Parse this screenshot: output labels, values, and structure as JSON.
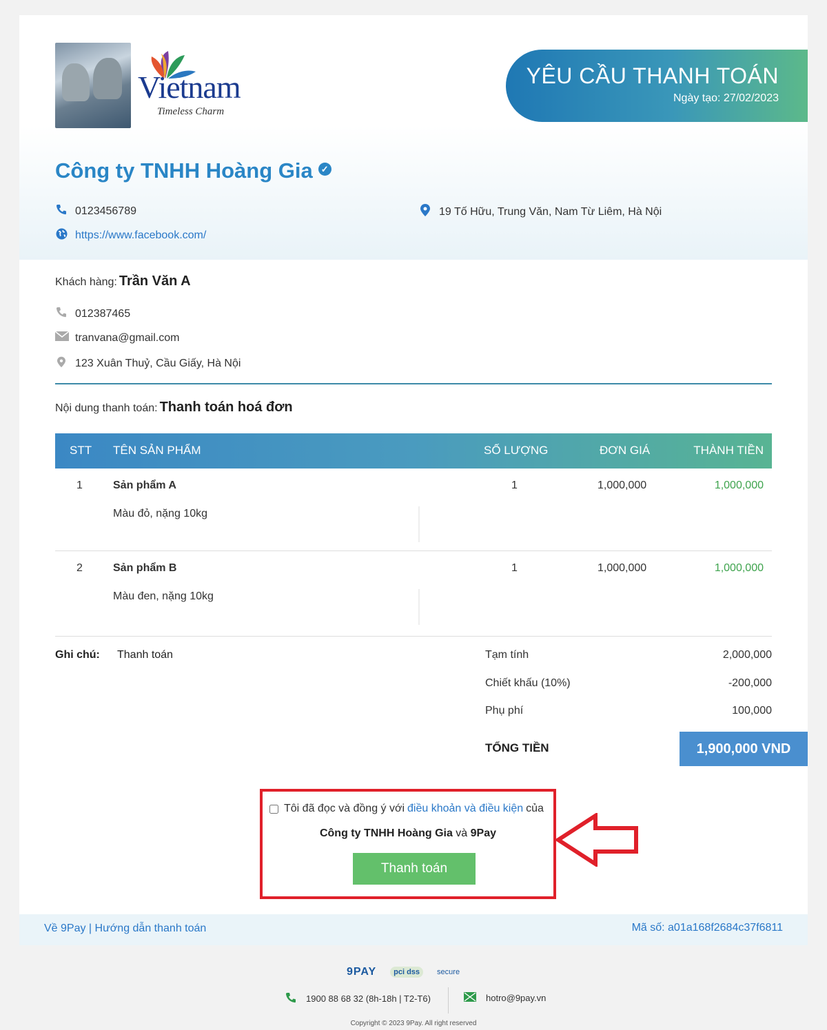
{
  "header": {
    "logo_word": "Vietnam",
    "logo_tagline": "Timeless Charm",
    "title": "YÊU CẦU THANH TOÁN",
    "created_date": "Ngày tạo: 27/02/2023"
  },
  "merchant": {
    "name": "Công ty TNHH Hoàng Gia",
    "phone": "0123456789",
    "address": "19 Tố Hữu, Trung Văn, Nam Từ Liêm, Hà Nội",
    "website": "https://www.facebook.com/"
  },
  "customer": {
    "label": "Khách hàng:",
    "name": "Trần Văn A",
    "phone": "012387465",
    "email": "tranvana@gmail.com",
    "address": "123 Xuân Thuỷ, Cầu Giấy, Hà Nội"
  },
  "payment": {
    "label": "Nội dung thanh toán:",
    "content": "Thanh toán hoá đơn"
  },
  "table": {
    "headers": {
      "stt": "STT",
      "product": "TÊN SẢN PHẨM",
      "qty": "SỐ LƯỢNG",
      "price": "ĐƠN GIÁ",
      "total": "THÀNH TIỀN"
    },
    "rows": [
      {
        "stt": "1",
        "name": "Sản phẩm A",
        "desc": "Màu đỏ, nặng 10kg",
        "qty": "1",
        "price": "1,000,000",
        "total": "1,000,000"
      },
      {
        "stt": "2",
        "name": "Sản phẩm B",
        "desc": "Màu đen, nặng 10kg",
        "qty": "1",
        "price": "1,000,000",
        "total": "1,000,000"
      }
    ]
  },
  "note": {
    "label": "Ghi chú:",
    "value": "Thanh toán"
  },
  "summary": {
    "subtotal_label": "Tạm tính",
    "subtotal": "2,000,000",
    "discount_label": "Chiết khấu (10%)",
    "discount": "-200,000",
    "fee_label": "Phụ phí",
    "fee": "100,000",
    "total_label": "TỔNG TIỀN",
    "total": "1,900,000 VND"
  },
  "consent": {
    "text_before": "Tôi đã đọc và đồng ý với ",
    "link": "điều khoản và điều kiện",
    "text_after": " của",
    "company": "Công ty TNHH Hoàng Gia",
    "and": " và ",
    "partner": "9Pay",
    "pay_button": "Thanh toán"
  },
  "footer": {
    "about": "Về 9Pay",
    "separator": " | ",
    "guide": "Hướng dẫn thanh toán",
    "code": "Mã số: a01a168f2684c37f6811",
    "brand_9pay": "9PAY",
    "brand_pci": "pci dss",
    "brand_secure": "secure",
    "hotline": "1900 88 68 32 (8h-18h | T2-T6)",
    "email": "hotro@9pay.vn",
    "copyright": "Copyright © 2023 9Pay. All right reserved"
  },
  "colors": {
    "accent": "#2a86c6",
    "green": "#3ea34d",
    "total_bg": "#4a8fcf",
    "button": "#63c06b",
    "highlight": "#e0202a"
  },
  "icons": [
    "phone-icon",
    "map-pin-icon",
    "globe-icon",
    "mail-icon",
    "verified-icon",
    "arrow-left-icon"
  ]
}
